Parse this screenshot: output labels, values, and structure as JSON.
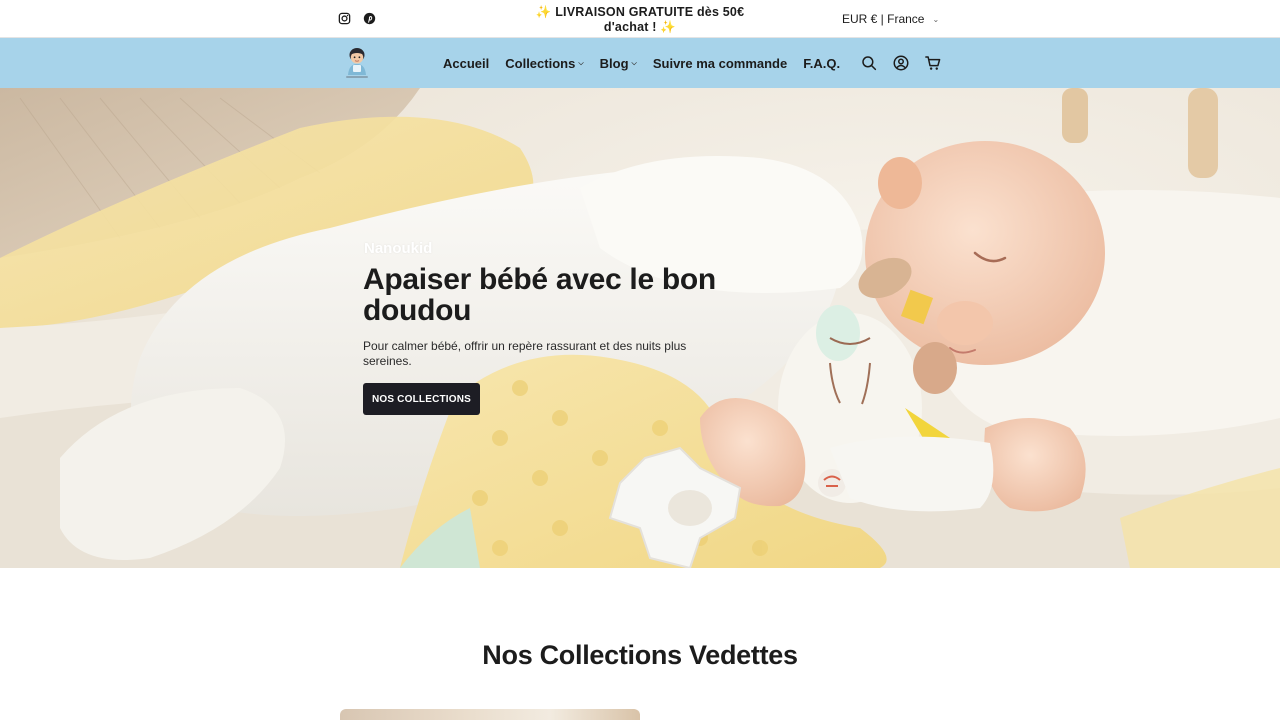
{
  "topbar": {
    "announcement": "✨ LIVRAISON GRATUITE dès 50€ d'achat ! ✨",
    "currency": "EUR € | France",
    "social": [
      "instagram-icon",
      "pinterest-icon"
    ]
  },
  "header": {
    "nav": [
      {
        "label": "Accueil",
        "dropdown": false
      },
      {
        "label": "Collections",
        "dropdown": true
      },
      {
        "label": "Blog",
        "dropdown": true
      },
      {
        "label": "Suivre ma commande",
        "dropdown": false
      },
      {
        "label": "F.A.Q.",
        "dropdown": false
      }
    ],
    "icons": [
      "search-icon",
      "account-icon",
      "cart-icon"
    ],
    "bg_color": "#a7d3ea"
  },
  "hero": {
    "brand": "Nanoukid",
    "title": "Apaiser bébé avec le bon doudou",
    "subtitle": "Pour calmer bébé, offrir un repère rassurant et des nuits plus sereines.",
    "cta": "NOS COLLECTIONS"
  },
  "collections": {
    "title": "Nos Collections Vedettes"
  }
}
